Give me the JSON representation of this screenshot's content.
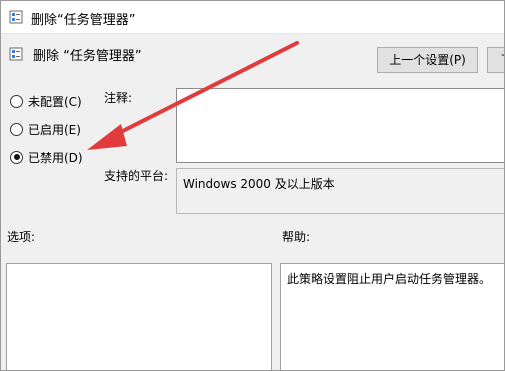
{
  "window": {
    "title": "删除“任务管理器”"
  },
  "header": {
    "title": "删除 “任务管理器”"
  },
  "nav": {
    "prev_label": "上一个设置(P)",
    "next_label": "下"
  },
  "radios": [
    {
      "label": "未配置(C)",
      "selected": false
    },
    {
      "label": "已启用(E)",
      "selected": false
    },
    {
      "label": "已禁用(D)",
      "selected": true
    }
  ],
  "labels": {
    "comment": "注释:",
    "platform": "支持的平台:",
    "options": "选项:",
    "help": "帮助:"
  },
  "fields": {
    "comment_value": "",
    "platform_value": "Windows 2000 及以上版本",
    "help_text": "此策略设置阻止用户启动任务管理器。"
  },
  "icons": {
    "title_icon": "policy-setting-icon",
    "header_icon": "policy-setting-icon",
    "arrow": "red-annotation-arrow"
  },
  "colors": {
    "annotation_red": "#e23b3b"
  }
}
